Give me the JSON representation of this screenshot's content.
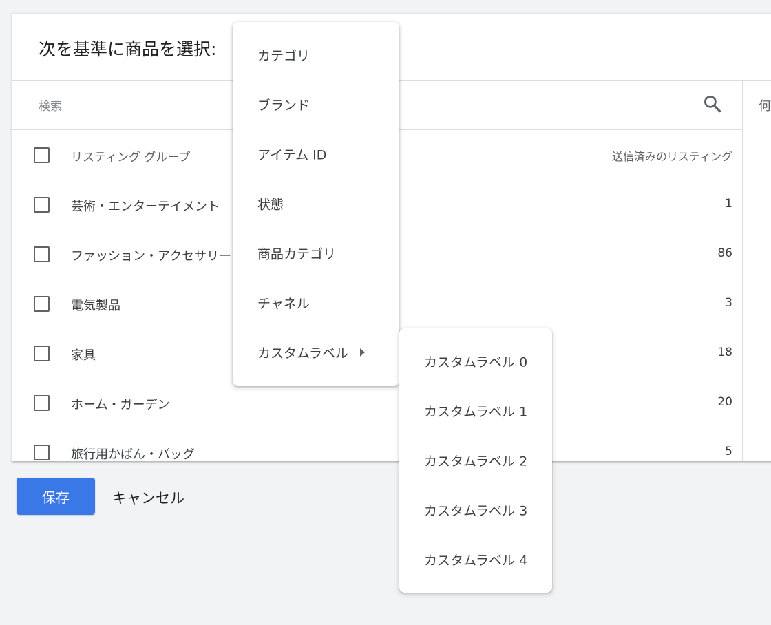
{
  "card": {
    "title": "次を基準に商品を選択:",
    "right_column_text": "何"
  },
  "search": {
    "placeholder": "検索",
    "icon": "search-icon"
  },
  "table": {
    "header_label": "リスティング グループ",
    "header_count": "送信済みのリスティング",
    "rows": [
      {
        "label": "芸術・エンターテイメント",
        "count": "1"
      },
      {
        "label": "ファッション・アクセサリー",
        "count": "86"
      },
      {
        "label": "電気製品",
        "count": "3"
      },
      {
        "label": "家具",
        "count": "18"
      },
      {
        "label": "ホーム・ガーデン",
        "count": "20"
      },
      {
        "label": "旅行用かばん・バッグ",
        "count": "5"
      }
    ]
  },
  "footer": {
    "save_label": "保存",
    "cancel_label": "キャンセル"
  },
  "menu": {
    "items": [
      {
        "label": "カテゴリ"
      },
      {
        "label": "ブランド"
      },
      {
        "label": "アイテム ID"
      },
      {
        "label": "状態"
      },
      {
        "label": "商品カテゴリ"
      },
      {
        "label": "チャネル"
      },
      {
        "label": "カスタムラベル",
        "has_submenu": true
      }
    ]
  },
  "submenu": {
    "items": [
      {
        "label": "カスタムラベル 0"
      },
      {
        "label": "カスタムラベル 1"
      },
      {
        "label": "カスタムラベル 2"
      },
      {
        "label": "カスタムラベル 3"
      },
      {
        "label": "カスタムラベル 4"
      }
    ]
  },
  "colors": {
    "primary_button": "#3b78e7",
    "accent": "#1a73e8",
    "background": "#f1f3f4"
  }
}
